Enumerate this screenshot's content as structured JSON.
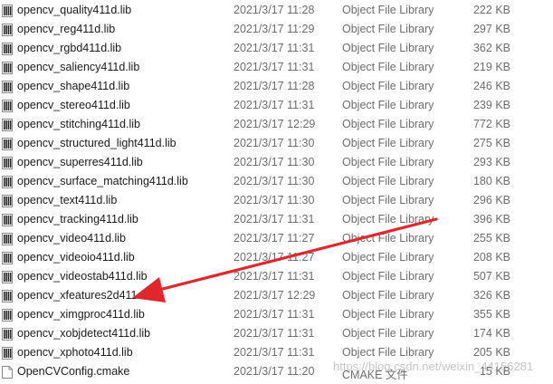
{
  "files": [
    {
      "name": "opencv_quality411d.lib",
      "date": "2021/3/17 11:28",
      "type": "Object File Library",
      "size": "222 KB",
      "icon": "lib-file-icon"
    },
    {
      "name": "opencv_reg411d.lib",
      "date": "2021/3/17 11:29",
      "type": "Object File Library",
      "size": "297 KB",
      "icon": "lib-file-icon"
    },
    {
      "name": "opencv_rgbd411d.lib",
      "date": "2021/3/17 11:31",
      "type": "Object File Library",
      "size": "362 KB",
      "icon": "lib-file-icon"
    },
    {
      "name": "opencv_saliency411d.lib",
      "date": "2021/3/17 11:31",
      "type": "Object File Library",
      "size": "219 KB",
      "icon": "lib-file-icon"
    },
    {
      "name": "opencv_shape411d.lib",
      "date": "2021/3/17 11:28",
      "type": "Object File Library",
      "size": "246 KB",
      "icon": "lib-file-icon"
    },
    {
      "name": "opencv_stereo411d.lib",
      "date": "2021/3/17 11:31",
      "type": "Object File Library",
      "size": "239 KB",
      "icon": "lib-file-icon"
    },
    {
      "name": "opencv_stitching411d.lib",
      "date": "2021/3/17 12:29",
      "type": "Object File Library",
      "size": "772 KB",
      "icon": "lib-file-icon"
    },
    {
      "name": "opencv_structured_light411d.lib",
      "date": "2021/3/17 11:30",
      "type": "Object File Library",
      "size": "275 KB",
      "icon": "lib-file-icon"
    },
    {
      "name": "opencv_superres411d.lib",
      "date": "2021/3/17 11:30",
      "type": "Object File Library",
      "size": "293 KB",
      "icon": "lib-file-icon"
    },
    {
      "name": "opencv_surface_matching411d.lib",
      "date": "2021/3/17 11:30",
      "type": "Object File Library",
      "size": "180 KB",
      "icon": "lib-file-icon"
    },
    {
      "name": "opencv_text411d.lib",
      "date": "2021/3/17 11:30",
      "type": "Object File Library",
      "size": "296 KB",
      "icon": "lib-file-icon"
    },
    {
      "name": "opencv_tracking411d.lib",
      "date": "2021/3/17 11:31",
      "type": "Object File Library",
      "size": "396 KB",
      "icon": "lib-file-icon"
    },
    {
      "name": "opencv_video411d.lib",
      "date": "2021/3/17 11:27",
      "type": "Object File Library",
      "size": "255 KB",
      "icon": "lib-file-icon"
    },
    {
      "name": "opencv_videoio411d.lib",
      "date": "2021/3/17 11:27",
      "type": "Object File Library",
      "size": "208 KB",
      "icon": "lib-file-icon"
    },
    {
      "name": "opencv_videostab411d.lib",
      "date": "2021/3/17 11:31",
      "type": "Object File Library",
      "size": "507 KB",
      "icon": "lib-file-icon"
    },
    {
      "name": "opencv_xfeatures2d411d.lib",
      "date": "2021/3/17 12:29",
      "type": "Object File Library",
      "size": "326 KB",
      "icon": "lib-file-icon"
    },
    {
      "name": "opencv_ximgproc411d.lib",
      "date": "2021/3/17 11:31",
      "type": "Object File Library",
      "size": "355 KB",
      "icon": "lib-file-icon"
    },
    {
      "name": "opencv_xobjdetect411d.lib",
      "date": "2021/3/17 11:31",
      "type": "Object File Library",
      "size": "174 KB",
      "icon": "lib-file-icon"
    },
    {
      "name": "opencv_xphoto411d.lib",
      "date": "2021/3/17 11:31",
      "type": "Object File Library",
      "size": "205 KB",
      "icon": "lib-file-icon"
    },
    {
      "name": "OpenCVConfig.cmake",
      "date": "2021/3/17 11:20",
      "type": "CMAKE 文件",
      "size": "15 KB",
      "icon": "cmake-file-icon"
    }
  ],
  "watermark": "https://blog.csdn.net/weixin_44156281",
  "colors": {
    "arrow": "#e0282c",
    "secondary_text": "#6d6d6d"
  }
}
